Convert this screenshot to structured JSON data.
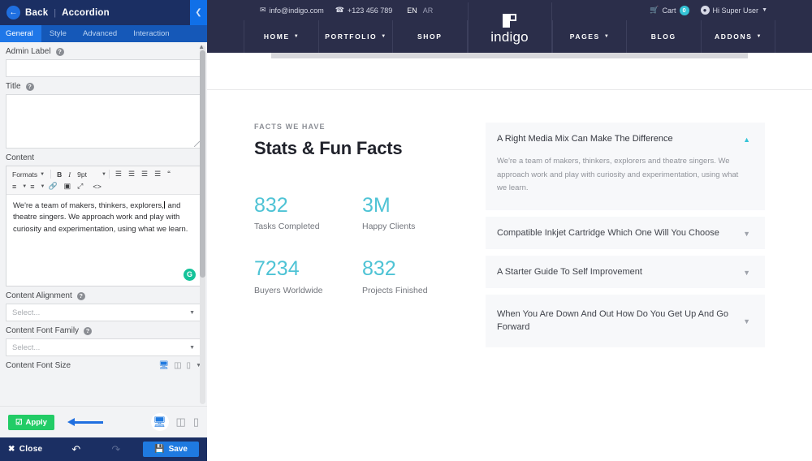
{
  "editor": {
    "header": {
      "back_label": "Back",
      "separator": "|",
      "module_title": "Accordion",
      "collapse_icon": "chevron-left-icon",
      "back_icon": "arrow-left-icon"
    },
    "tabs": [
      {
        "label": "General",
        "active": true
      },
      {
        "label": "Style",
        "active": false
      },
      {
        "label": "Advanced",
        "active": false
      },
      {
        "label": "Interaction",
        "active": false
      }
    ],
    "fields": {
      "admin_label": {
        "label": "Admin Label",
        "value": "",
        "help": "?"
      },
      "title": {
        "label": "Title",
        "value": "",
        "help": "?"
      },
      "content": {
        "label": "Content",
        "value": "We're a team of makers, thinkers, explorers, and theatre singers. We approach work and play with curiosity and experimentation, using what we learn.",
        "value_part1": "We're a team of makers, thinkers, explorers,",
        "value_part2": " and theatre singers. We approach work and play with curiosity and experimentation, using what we learn."
      },
      "content_alignment": {
        "label": "Content Alignment",
        "placeholder": "Select...",
        "value": "",
        "help": "?"
      },
      "content_font_family": {
        "label": "Content Font Family",
        "placeholder": "Select...",
        "value": "",
        "help": "?"
      },
      "content_font_size": {
        "label": "Content Font Size"
      }
    },
    "rte_toolbar": {
      "formats_label": "Formats",
      "bold": "B",
      "italic": "I",
      "font_size": "9pt",
      "align_left": "align-left-icon",
      "align_center": "align-center-icon",
      "align_right": "align-right-icon",
      "align_justify": "align-justify-icon",
      "blockquote": "“",
      "bullet_list": "bullet-list-icon",
      "numbered_list": "numbered-list-icon",
      "link": "link-icon",
      "image": "image-icon",
      "fullscreen": "fullscreen-icon",
      "source_code": "<>",
      "grammarly": "G"
    },
    "device_toggles": [
      {
        "name": "desktop",
        "active": true
      },
      {
        "name": "tablet",
        "active": false
      },
      {
        "name": "mobile",
        "active": false
      }
    ],
    "actions": {
      "apply_label": "Apply",
      "apply_icon": "check-square-icon",
      "close_label": "Close",
      "close_icon": "close-x-icon",
      "undo_icon": "undo-icon",
      "redo_icon": "redo-icon",
      "save_label": "Save",
      "save_icon": "floppy-disk-icon"
    },
    "annotation": {
      "type": "arrow",
      "points_to": "apply-button",
      "color": "#1f6fe0"
    }
  },
  "site": {
    "topbar": {
      "email": "info@indigo.com",
      "email_icon": "envelope-icon",
      "phone": "+123 456 789",
      "phone_icon": "phone-icon",
      "lang_active": "EN",
      "lang_inactive": "AR",
      "cart_label": "Cart",
      "cart_icon": "cart-icon",
      "cart_count": "0",
      "user_icon": "user-circle-icon",
      "user_label": "Hi Super User",
      "user_caret": "chevron-down-icon"
    },
    "logo": {
      "text": "indigo",
      "mark": "square-notch-logo"
    },
    "nav_left": [
      {
        "label": "HOME",
        "caret": true
      },
      {
        "label": "PORTFOLIO",
        "caret": true
      },
      {
        "label": "SHOP",
        "caret": false
      }
    ],
    "nav_right": [
      {
        "label": "PAGES",
        "caret": true
      },
      {
        "label": "BLOG",
        "caret": false
      },
      {
        "label": "ADDONS",
        "caret": true
      }
    ],
    "section": {
      "eyebrow": "FACTS WE HAVE",
      "title": "Stats & Fun Facts",
      "stats": [
        {
          "number": "832",
          "label": "Tasks Completed"
        },
        {
          "number": "3M",
          "label": "Happy Clients"
        },
        {
          "number": "7234",
          "label": "Buyers Worldwide"
        },
        {
          "number": "832",
          "label": "Projects Finished"
        }
      ],
      "accordion": [
        {
          "title": "A Right Media Mix Can Make The Difference",
          "body": "We're a team of makers, thinkers, explorers and theatre singers. We approach work and play with curiosity and experimentation, using what we learn.",
          "open": true,
          "icon": "chevron-up-icon"
        },
        {
          "title": "Compatible Inkjet Cartridge Which One Will You Choose",
          "body": "",
          "open": false,
          "icon": "chevron-down-icon"
        },
        {
          "title": "A Starter Guide To Self Improvement",
          "body": "",
          "open": false,
          "icon": "chevron-down-icon"
        },
        {
          "title": "When You Are Down And Out How Do You Get Up And Go Forward",
          "body": "",
          "open": false,
          "icon": "chevron-down-icon"
        }
      ]
    }
  },
  "colors": {
    "panel_header": "#1b2f63",
    "tab_active": "#1f77e8",
    "apply_green": "#22cc66",
    "save_blue": "#1f7ae0",
    "site_navy": "#2b2e4a",
    "accent_teal": "#4ec3d5"
  }
}
